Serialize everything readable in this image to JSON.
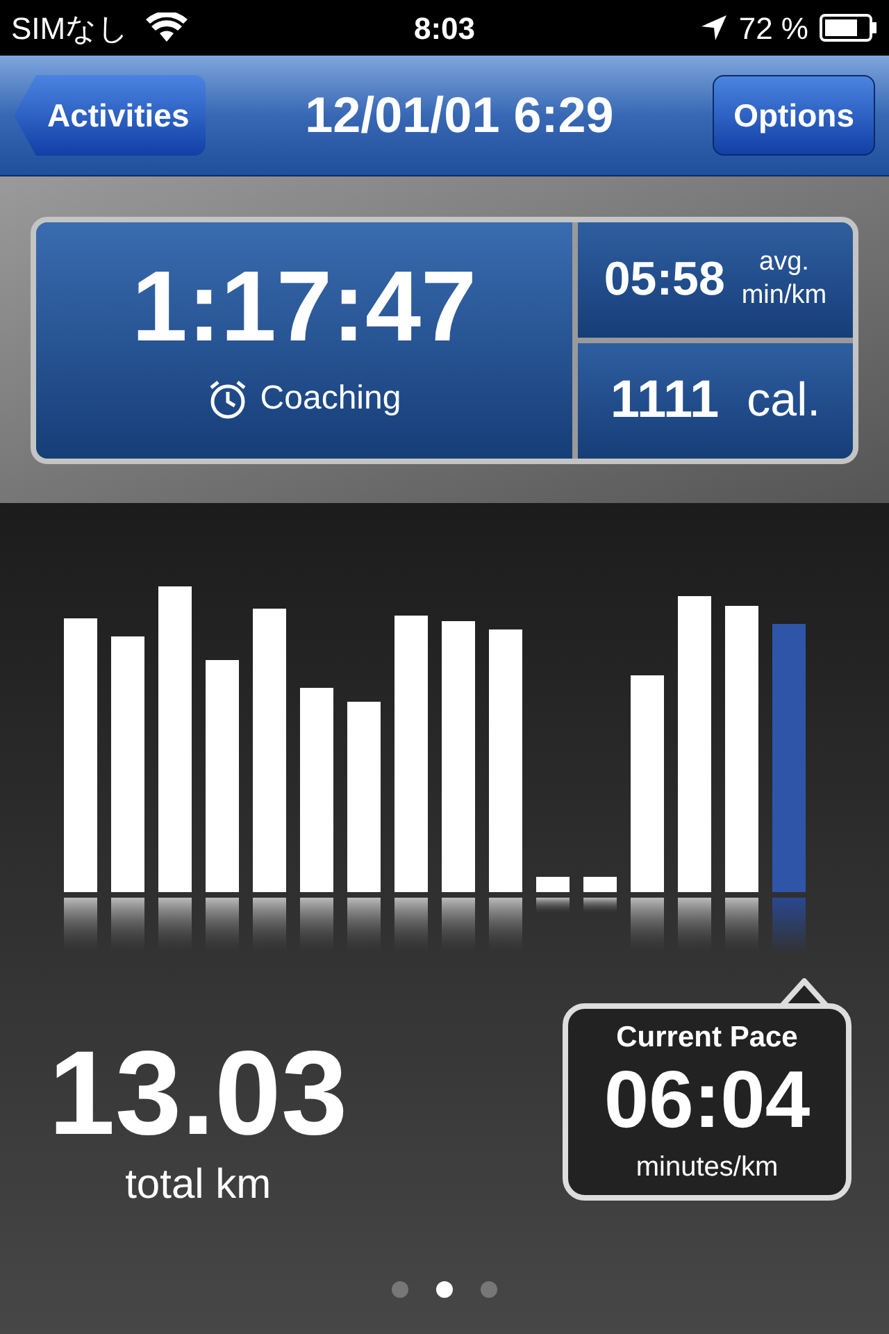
{
  "status_bar": {
    "carrier": "SIMなし",
    "time": "8:03",
    "battery": "72 %"
  },
  "nav_bar": {
    "back_button": "Activities",
    "title": "12/01/01 6:29",
    "right_button": "Options"
  },
  "summary": {
    "duration": "1:17:47",
    "coaching": "Coaching",
    "avg_pace": "05:58",
    "avg_label": "avg.",
    "avg_unit": "min/km",
    "calories": "1111",
    "calories_unit": "cal."
  },
  "distance": {
    "value": "13.03",
    "label": "total km"
  },
  "current_pace": {
    "title": "Current Pace",
    "value": "06:04",
    "unit": "minutes/km"
  },
  "pages": [
    {
      "selected": false
    },
    {
      "selected": true
    },
    {
      "selected": false
    }
  ]
}
